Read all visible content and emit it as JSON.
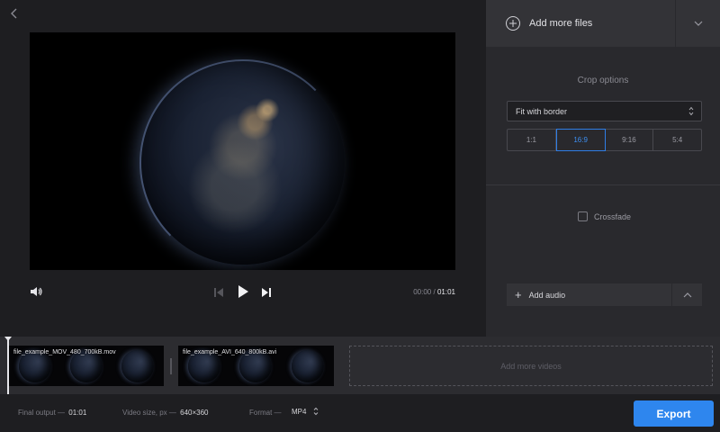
{
  "player": {
    "time_current": "00:00",
    "time_separator": "/",
    "time_total": "01:01"
  },
  "panel": {
    "add_files_label": "Add more files",
    "crop_title": "Crop options",
    "crop_mode": "Fit with border",
    "ratios": [
      "1:1",
      "16:9",
      "9:16",
      "5:4"
    ],
    "active_ratio": "16:9",
    "crossfade_label": "Crossfade",
    "crossfade_checked": false,
    "add_audio_label": "Add audio",
    "add_audio_plus": "+"
  },
  "timeline": {
    "clips": [
      {
        "name": "file_example_MOV_480_700kB.mov"
      },
      {
        "name": "file_example_AVI_640_800kB.avi"
      }
    ],
    "add_more_label": "Add more videos"
  },
  "bottom": {
    "final_output_label": "Final output —",
    "final_output_value": "01:01",
    "video_size_label": "Video size, px —",
    "video_size_value": "640×360",
    "format_label": "Format —",
    "format_value": "MP4",
    "export_label": "Export"
  },
  "colors": {
    "accent": "#2e86ee",
    "panel_bg": "#29292d",
    "app_bg": "#1e1e21"
  },
  "icons": {
    "back": "chevron-left-icon",
    "volume": "volume-icon",
    "prev": "skip-previous-icon",
    "play": "play-icon",
    "next": "skip-next-icon",
    "add_files": "plus-circle-icon",
    "files_dropdown": "chevron-down-icon",
    "select_arrows": "sort-arrows-icon",
    "audio_toggle": "chevron-up-icon"
  }
}
